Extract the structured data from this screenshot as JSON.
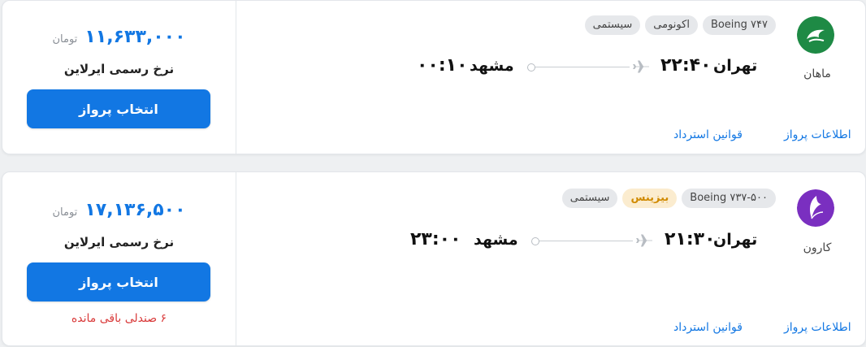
{
  "flights": [
    {
      "airline": "ماهان",
      "logo_icon": "mahan-logo-icon",
      "logo_color": "#1e8a45",
      "chips": [
        "سیستمی",
        "اکونومی",
        "Boeing ۷۴۷"
      ],
      "origin": "تهران",
      "departure_time": "۲۲:۴۰",
      "destination": "مشهد",
      "arrival_time": "۰۰:۱۰",
      "price": "۱۱,۶۳۳,۰۰۰",
      "currency": "تومان",
      "rate_label": "نرخ رسمی ایرلاین",
      "select_label": "انتخاب پرواز",
      "flight_info_label": "اطلاعات پرواز",
      "refund_rules_label": "قوانین استرداد"
    },
    {
      "airline": "کارون",
      "logo_icon": "karun-logo-icon",
      "logo_color": "#7a2fc0",
      "chips": [
        "سیستمی",
        "بیزینس",
        "Boeing ۷۳۷-۵۰۰"
      ],
      "origin": "تهران",
      "departure_time": "۲۱:۳۰",
      "destination": "مشهد",
      "arrival_time": "۲۳:۰۰",
      "price": "۱۷,۱۳۶,۵۰۰",
      "currency": "تومان",
      "rate_label": "نرخ رسمی ایرلاین",
      "select_label": "انتخاب پرواز",
      "seats_left": "۶ صندلی باقی مانده",
      "flight_info_label": "اطلاعات پرواز",
      "refund_rules_label": "قوانین استرداد"
    }
  ],
  "colors": {
    "accent": "#1277e3",
    "warning": "#d93a3a",
    "business_chip_text": "#d08a00",
    "business_chip_bg": "#fbeccf"
  }
}
